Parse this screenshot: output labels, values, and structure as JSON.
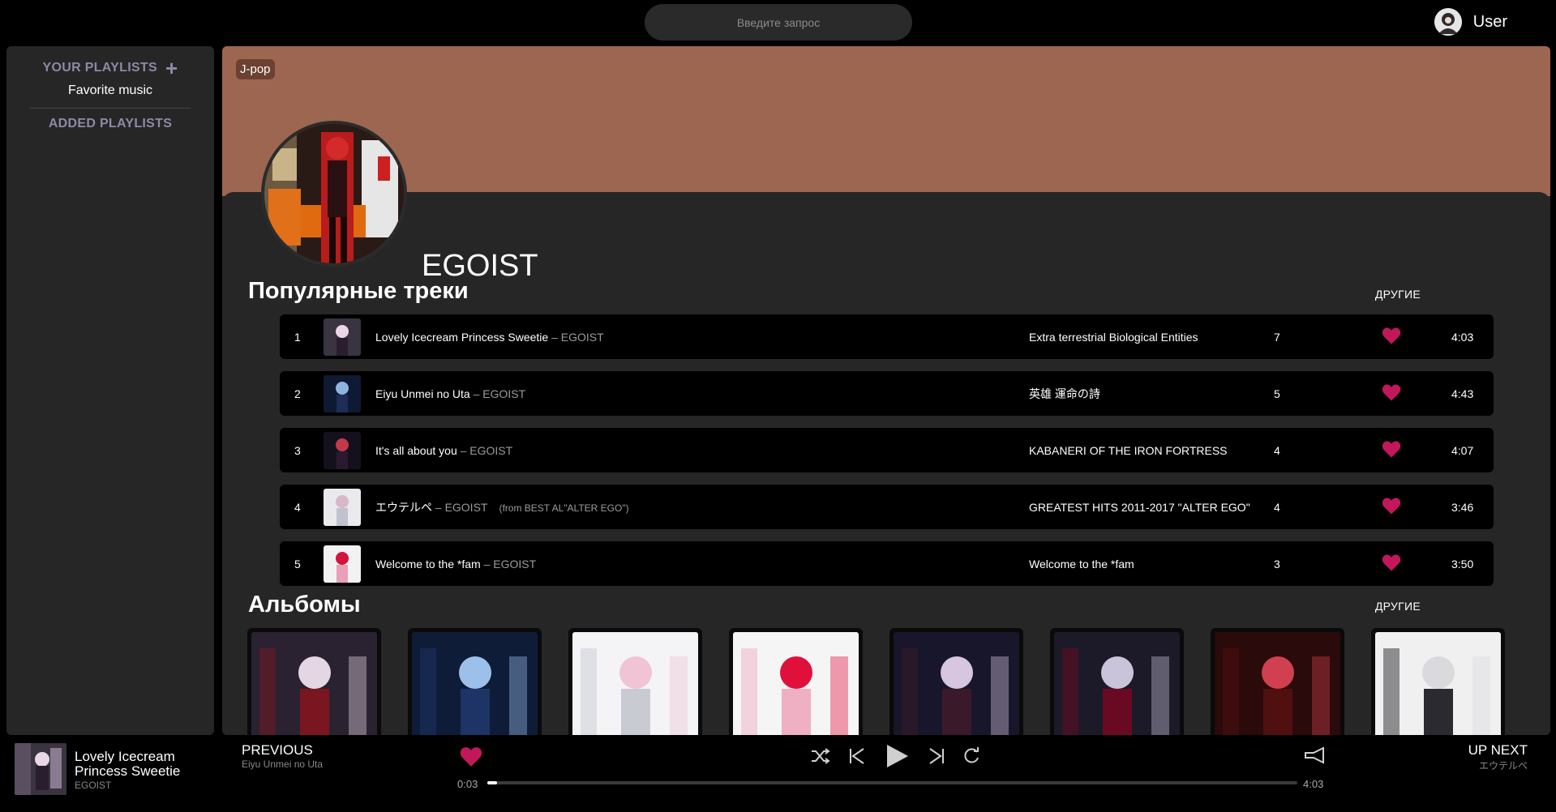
{
  "header": {
    "search_placeholder": "Введите запрос",
    "user_name": "User"
  },
  "sidebar": {
    "your_playlists": "YOUR PLAYLISTS",
    "playlists": [
      "Favorite music"
    ],
    "added_playlists": "ADDED PLAYLISTS"
  },
  "artist": {
    "genre": "J-pop",
    "name": "EGOIST",
    "banner_color": "#9c6650"
  },
  "popular": {
    "title": "Популярные треки",
    "more": "ДРУГИЕ",
    "tracks": [
      {
        "num": "1",
        "title": "Lovely Icecream Princess Sweetie",
        "artist": "– EGOIST",
        "note": "",
        "album": "Extra terrestrial Biological Entities",
        "plays": "7",
        "duration": "4:03"
      },
      {
        "num": "2",
        "title": "Eiyu Unmei no Uta",
        "artist": "– EGOIST",
        "note": "",
        "album": "英雄 運命の詩",
        "plays": "5",
        "duration": "4:43"
      },
      {
        "num": "3",
        "title": "It's all about you",
        "artist": "– EGOIST",
        "note": "",
        "album": "KABANERI OF THE IRON FORTRESS",
        "plays": "4",
        "duration": "4:07"
      },
      {
        "num": "4",
        "title": "エウテルペ",
        "artist": "– EGOIST",
        "note": "(from BEST AL\"ALTER EGO\")",
        "album": "GREATEST HITS 2011-2017 \"ALTER EGO\"",
        "plays": "4",
        "duration": "3:46"
      },
      {
        "num": "5",
        "title": "Welcome to the *fam",
        "artist": "– EGOIST",
        "note": "",
        "album": "Welcome to the *fam",
        "plays": "3",
        "duration": "3:50"
      }
    ]
  },
  "albums": {
    "title": "Альбомы",
    "more": "ДРУГИЕ",
    "count": 8
  },
  "player": {
    "now_playing_title": "Lovely Icecream Princess Sweetie",
    "now_playing_artist": "EGOIST",
    "previous_label": "PREVIOUS",
    "previous_track": "Eiyu Unmei no Uta",
    "current_time": "0:03",
    "total_time": "4:03",
    "progress_fraction": 0.012,
    "up_next_label": "UP NEXT",
    "up_next_track": "エウテルペ"
  },
  "colors": {
    "accent_heart": "#c2185b",
    "sidebar_heading": "#8f88a6"
  },
  "icons": [
    "plus-icon",
    "user-avatar-icon",
    "heart-icon",
    "shuffle-icon",
    "previous-icon",
    "play-icon",
    "next-icon",
    "repeat-icon",
    "volume-icon"
  ]
}
